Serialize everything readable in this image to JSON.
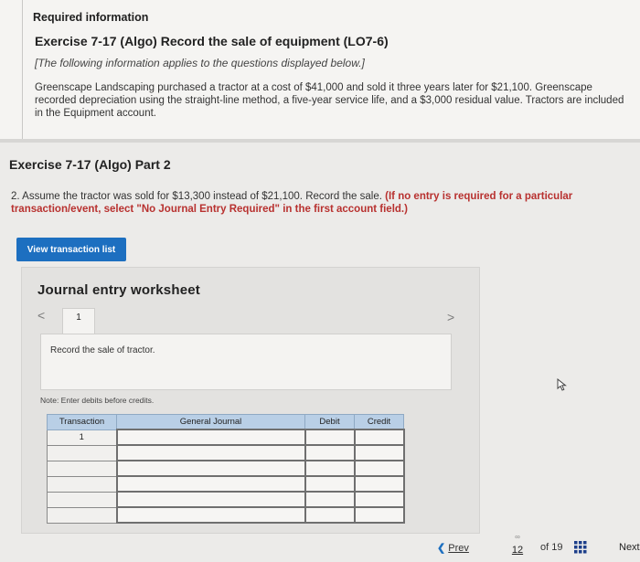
{
  "header": {
    "required": "Required information",
    "exercise_title": "Exercise 7-17 (Algo) Record the sale of equipment (LO7-6)",
    "note": "[The following information applies to the questions displayed below.]",
    "description": "Greenscape Landscaping purchased a tractor at a cost of $41,000 and sold it three years later for $21,100. Greenscape recorded depreciation using the straight-line method, a five-year service life, and a $3,000 residual value. Tractors are included in the Equipment account."
  },
  "part": {
    "title": "Exercise 7-17 (Algo) Part 2",
    "question": "2. Assume the tractor was sold for $13,300 instead of $21,100. Record the sale.",
    "instruction": "(If no entry is required for a particular transaction/event, select \"No Journal Entry Required\" in the first account field.)"
  },
  "buttons": {
    "view_transaction_list": "View transaction list"
  },
  "worksheet": {
    "title": "Journal entry worksheet",
    "tab_number": "1",
    "prev_arrow": "<",
    "next_arrow": ">",
    "entry_description": "Record the sale of tractor.",
    "note": "Note: Enter debits before credits."
  },
  "journal": {
    "headers": [
      "Transaction",
      "General Journal",
      "Debit",
      "Credit"
    ],
    "rows": [
      {
        "transaction": "1"
      },
      {
        "transaction": ""
      },
      {
        "transaction": ""
      },
      {
        "transaction": ""
      },
      {
        "transaction": ""
      },
      {
        "transaction": ""
      }
    ]
  },
  "navigation": {
    "prev_label": "Prev",
    "current_page": "12",
    "of_label": "of 19",
    "next_label": "Next"
  },
  "colors": {
    "primary_button": "#1d6fc0",
    "table_header": "#b9cfe6",
    "instruction_red": "#b8312f"
  },
  "icons": [
    "chevron-left-icon",
    "chevron-right-icon",
    "link-icon",
    "grid-icon",
    "cursor-icon"
  ]
}
